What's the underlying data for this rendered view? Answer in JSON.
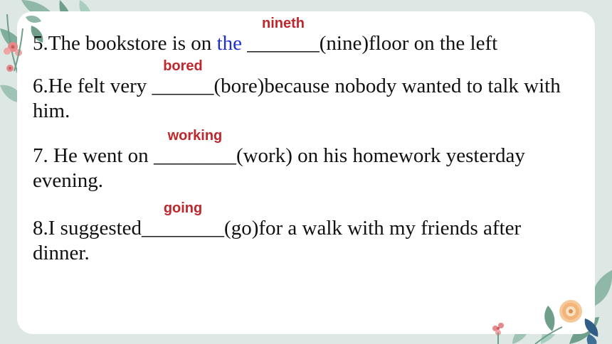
{
  "questions": [
    {
      "num": "5.",
      "before": "The bookstore is on ",
      "highlight": "the",
      "space": " ",
      "blank": "_______",
      "answer": "nineth",
      "after": "(nine)floor on the left"
    },
    {
      "num": "6.",
      "before": "He felt very ",
      "blank": "______",
      "answer": "bored",
      "after": "(bore)because nobody wanted to talk with him."
    },
    {
      "num": "7.",
      "before": " He went on ",
      "blank": "________",
      "answer": "working",
      "after": "(work) on his homework yesterday evening."
    },
    {
      "num": "8.",
      "before": "I suggested",
      "blank": "________",
      "answer": "going",
      "after": "(go)for a walk with my friends after dinner."
    }
  ],
  "colors": {
    "background": "#dde7e3",
    "card": "#ffffff",
    "answer": "#c0272d",
    "highlight": "#1f2fd6"
  }
}
